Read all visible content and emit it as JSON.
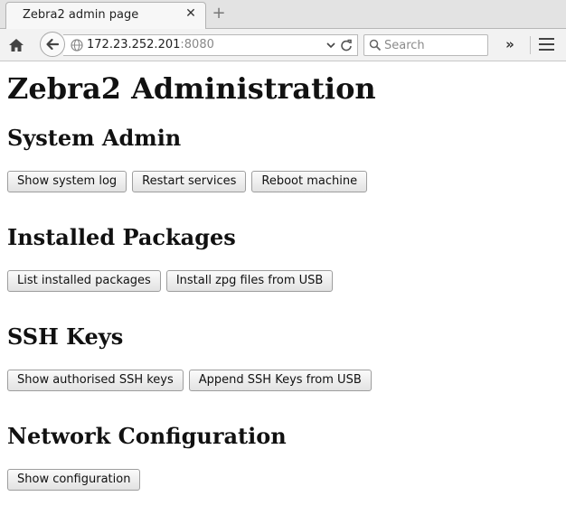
{
  "browser": {
    "tab_title": "Zebra2 admin page",
    "url_host": "172.23.252.201",
    "url_port": ":8080",
    "search_placeholder": "Search"
  },
  "page": {
    "title": "Zebra2 Administration",
    "sections": [
      {
        "heading": "System Admin",
        "buttons": [
          "Show system log",
          "Restart services",
          "Reboot machine"
        ]
      },
      {
        "heading": "Installed Packages",
        "buttons": [
          "List installed packages",
          "Install zpg files from USB"
        ]
      },
      {
        "heading": "SSH Keys",
        "buttons": [
          "Show authorised SSH keys",
          "Append SSH Keys from USB"
        ]
      },
      {
        "heading": "Network Configuration",
        "buttons": [
          "Show configuration"
        ]
      }
    ]
  }
}
